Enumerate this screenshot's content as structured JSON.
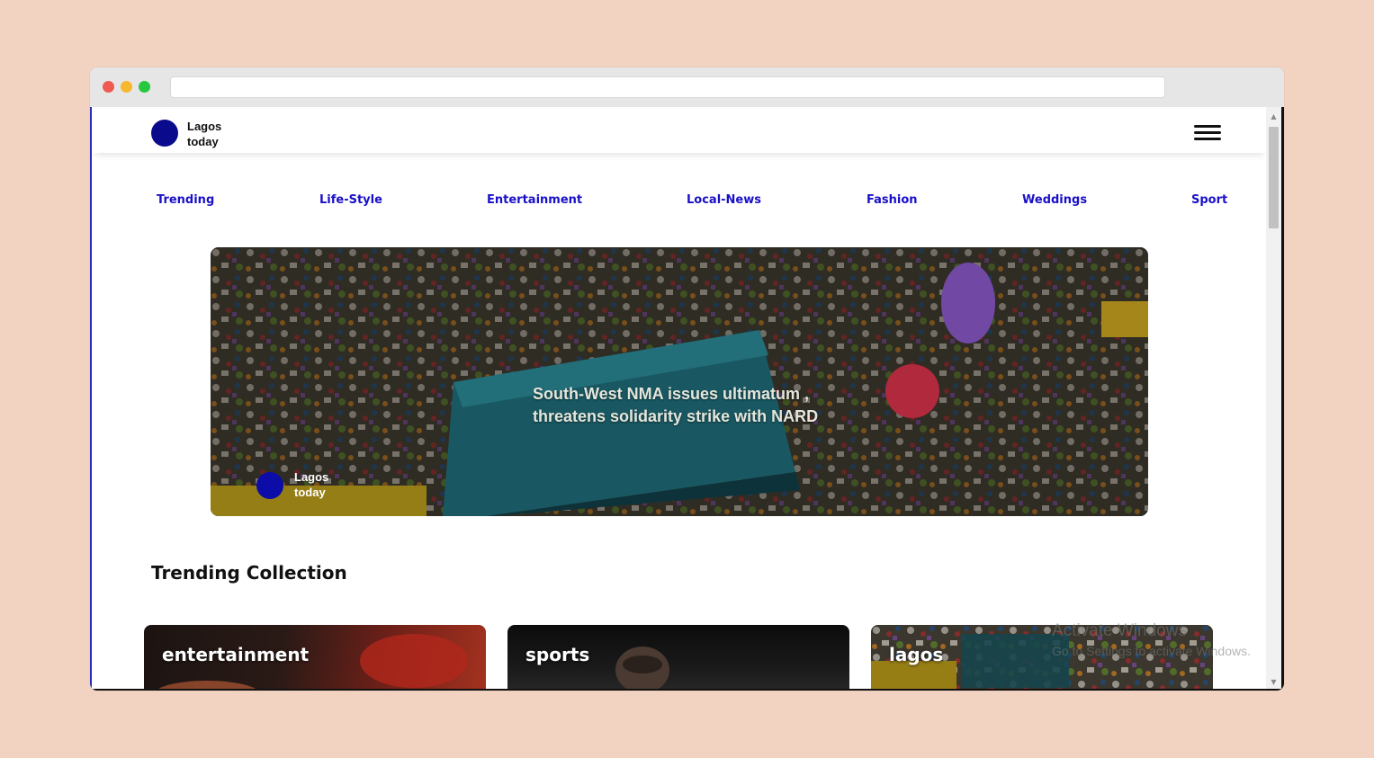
{
  "site": {
    "logo_line1": "Lagos",
    "logo_line2": "today",
    "brand_color": "#0a0a8c"
  },
  "nav": {
    "items": [
      "Trending",
      "Life-Style",
      "Entertainment",
      "Local-News",
      "Fashion",
      "Weddings",
      "Sport"
    ],
    "link_color": "#1a10c8"
  },
  "hero": {
    "title_line1": "South-West NMA issues ultimatum ,",
    "title_line2": "threatens solidarity strike with NARD",
    "badge_line1": "Lagos",
    "badge_line2": "today"
  },
  "trending": {
    "title": "Trending Collection",
    "cards": [
      "entertainment",
      "sports",
      "lagos"
    ]
  },
  "watermark": {
    "line1": "Activate Windows",
    "line2": "Go to Settings to activate Windows."
  },
  "icons": {
    "menu": "hamburger-icon",
    "scroll_up": "chevron-up-icon",
    "scroll_down": "chevron-down-icon"
  }
}
